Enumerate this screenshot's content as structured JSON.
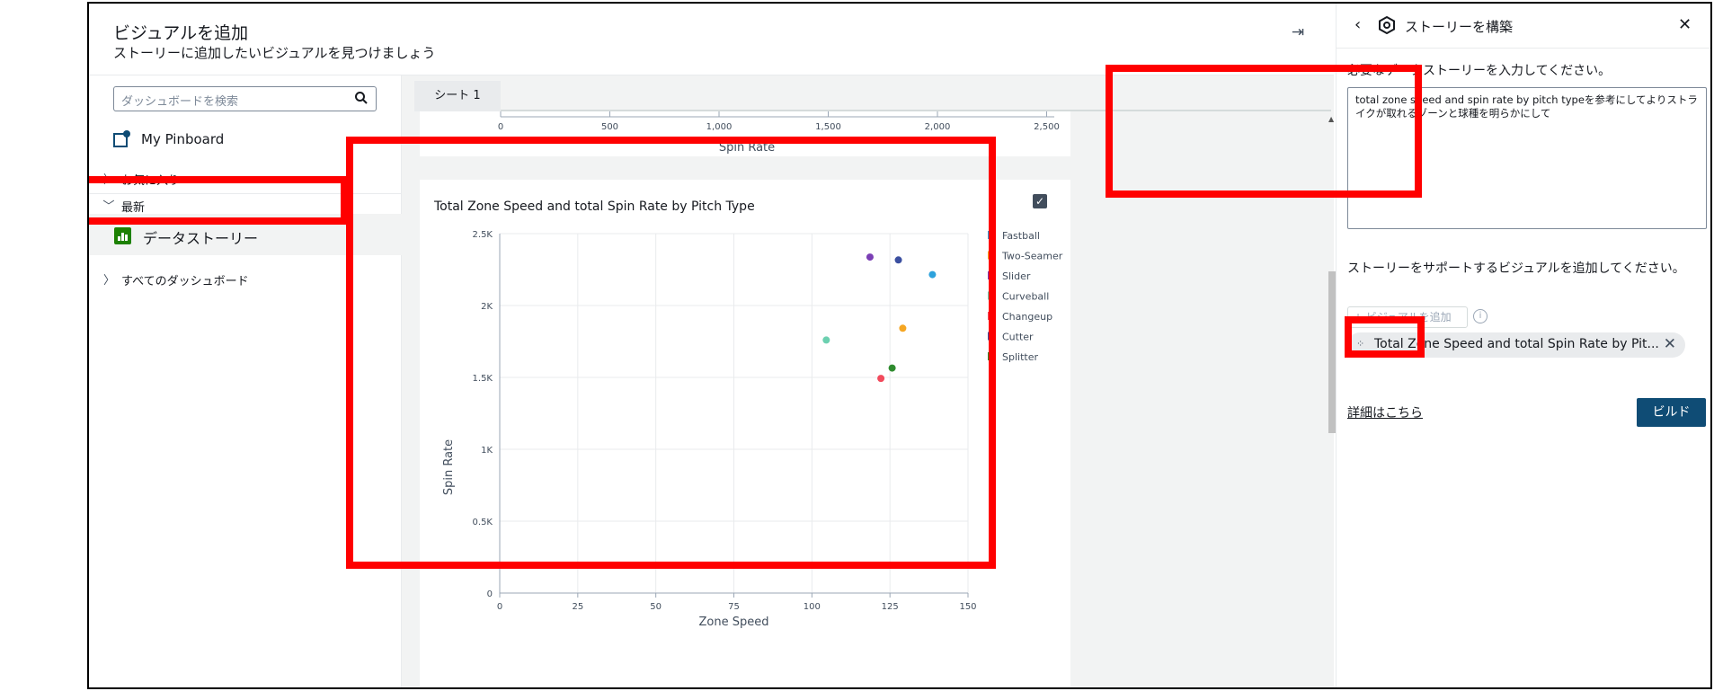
{
  "dialog": {
    "title": "ビジュアルを追加",
    "subtitle": "ストーリーに追加したいビジュアルを見つけましょう"
  },
  "sidebar": {
    "search_placeholder": "ダッシュボードを検索",
    "pinboard": "My Pinboard",
    "favorites": "お気に入り",
    "recent": "最新",
    "data_story": "データストーリー",
    "all_dashboards": "すべてのダッシュボード"
  },
  "tabs": [
    "シート 1"
  ],
  "top_visual": {
    "x_ticks": [
      "0",
      "500",
      "1,000",
      "1,500",
      "2,000",
      "2,500"
    ],
    "x_label": "Spin Rate"
  },
  "chart_data": {
    "type": "scatter",
    "title": "Total Zone Speed and total Spin Rate by Pitch Type",
    "xlabel": "Zone Speed",
    "ylabel": "Spin Rate",
    "xlim": [
      0,
      150
    ],
    "ylim": [
      0,
      2500
    ],
    "x_ticks": [
      "0",
      "25",
      "50",
      "75",
      "100",
      "125",
      "150"
    ],
    "y_ticks": [
      "0",
      "0.5K",
      "1K",
      "1.5K",
      "2K",
      "2.5K"
    ],
    "grid": true,
    "legend_position": "right",
    "series": [
      {
        "name": "Fastball",
        "color": "#2ea2dc",
        "x": 138.6,
        "y": 2215
      },
      {
        "name": "Two-Seamer",
        "color": "#f5a623",
        "x": 129.1,
        "y": 1842
      },
      {
        "name": "Slider",
        "color": "#7b3fb5",
        "x": 118.6,
        "y": 2337
      },
      {
        "name": "Curveball",
        "color": "#6cd0b0",
        "x": 104.6,
        "y": 1760
      },
      {
        "name": "Changeup",
        "color": "#f24a5c",
        "x": 122.1,
        "y": 1493
      },
      {
        "name": "Cutter",
        "color": "#3b4fa0",
        "x": 127.7,
        "y": 2317
      },
      {
        "name": "Splitter",
        "color": "#2e8b2e",
        "x": 125.7,
        "y": 1565
      }
    ]
  },
  "panel": {
    "title": "ストーリーを構築",
    "prompt_label": "必要なデータストーリーを入力してください。",
    "prompt_text": "total zone speed and spin rate by pitch typeを参考にしてよりストライクが取れるゾーンと球種を明らかにして",
    "support_label": "ストーリーをサポートするビジュアルを追加してください。",
    "add_visual_button": "+ ビジュアルを追加",
    "visual_token": "Total Zone Speed and total Spin Rate by Pit...",
    "learn_more": "詳細はこちら",
    "build_button": "ビルド"
  }
}
